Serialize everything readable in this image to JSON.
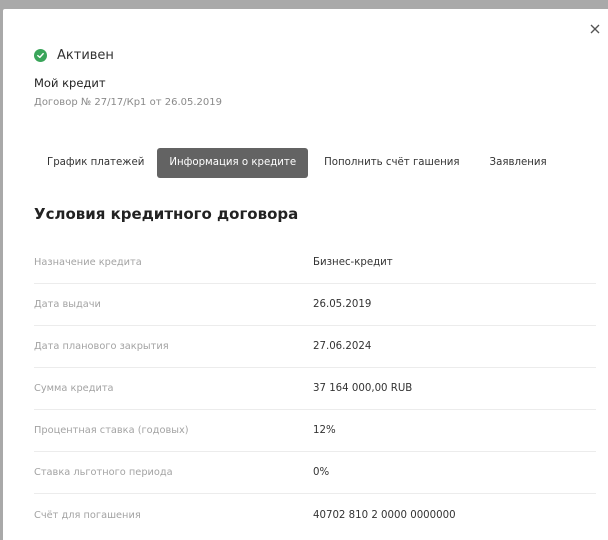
{
  "status": {
    "label": "Активен",
    "color": "#3aa55a",
    "icon": "check-circle-icon"
  },
  "loan": {
    "name": "Мой кредит",
    "contract": "Договор № 27/17/Кр1 от 26.05.2019"
  },
  "tabs": [
    {
      "label": "График платежей",
      "active": false
    },
    {
      "label": "Информация о кредите",
      "active": true
    },
    {
      "label": "Пополнить счёт гашения",
      "active": false
    },
    {
      "label": "Заявления",
      "active": false
    }
  ],
  "section": {
    "title": "Условия кредитного договора"
  },
  "details": [
    {
      "label": "Назначение кредита",
      "value": "Бизнес-кредит"
    },
    {
      "label": "Дата выдачи",
      "value": "26.05.2019"
    },
    {
      "label": "Дата планового закрытия",
      "value": "27.06.2024"
    },
    {
      "label": "Сумма кредита",
      "value": "37 164 000,00 RUB"
    },
    {
      "label": "Процентная ставка (годовых)",
      "value": "12%"
    },
    {
      "label": "Ставка льготного периода",
      "value": "0%"
    },
    {
      "label": "Счёт для погашения",
      "value": "40702 810 2 0000 0000000"
    }
  ],
  "colors": {
    "active_tab": "#636363",
    "overlay": "#a9a9a9"
  }
}
